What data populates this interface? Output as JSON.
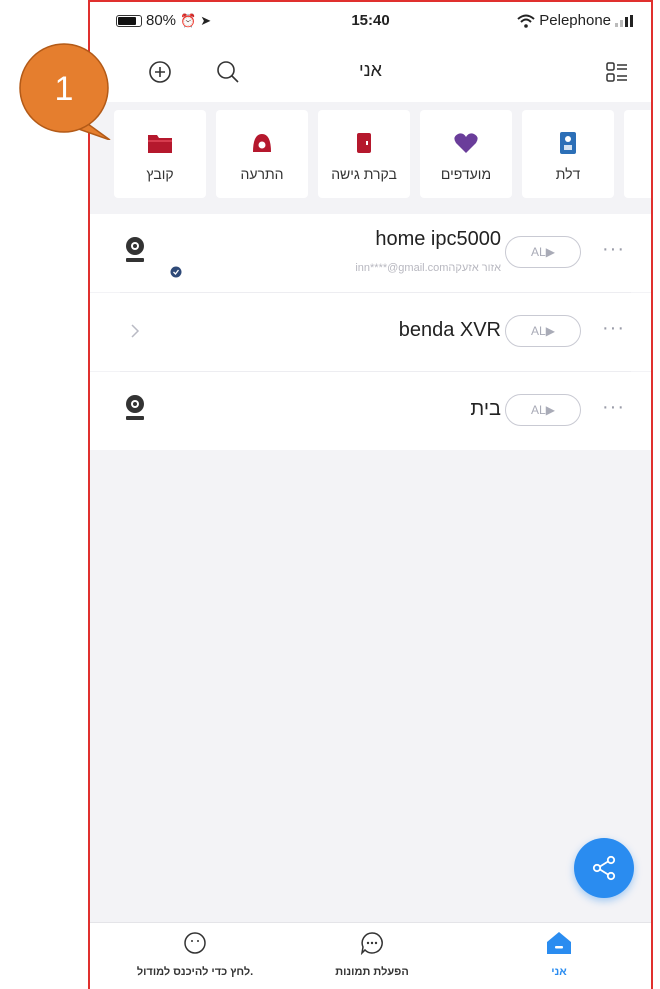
{
  "status_bar": {
    "battery": "80%",
    "time": "15:40",
    "carrier": "Pelephone"
  },
  "header": {
    "title": "אני"
  },
  "categories": [
    {
      "label": "קובץ",
      "icon": "folder-icon",
      "color": "#b5182d"
    },
    {
      "label": "התרעה",
      "icon": "alarm-icon",
      "color": "#b5182d"
    },
    {
      "label": "בקרת גישה",
      "icon": "access-control-icon",
      "color": "#b5182d"
    },
    {
      "label": "מועדפים",
      "icon": "heart-icon",
      "color": "#6a3d9a"
    },
    {
      "label": "דלת",
      "icon": "door-icon",
      "color": "#2c6fb7"
    }
  ],
  "devices": [
    {
      "name": "home ipc5000",
      "sub": "inn****@gmail.comאזור אזעקה",
      "al": "AL▶",
      "icon": "camera-icon"
    },
    {
      "name": "benda XVR",
      "al": "AL▶",
      "icon": "chevron-right-icon"
    },
    {
      "name": "בית",
      "al": "AL▶",
      "icon": "camera-icon"
    }
  ],
  "more_label": "···",
  "tabs": [
    {
      "label": "לחץ כדי להיכנס למודול.",
      "icon": "chat-bubble-icon"
    },
    {
      "label": "הפעלת תמונות",
      "icon": "chat-dots-icon"
    },
    {
      "label": "אני",
      "icon": "home-icon",
      "active": true
    }
  ],
  "callout": {
    "number": "1",
    "color": "#e57e2e"
  },
  "accent": "#2a8cf0"
}
